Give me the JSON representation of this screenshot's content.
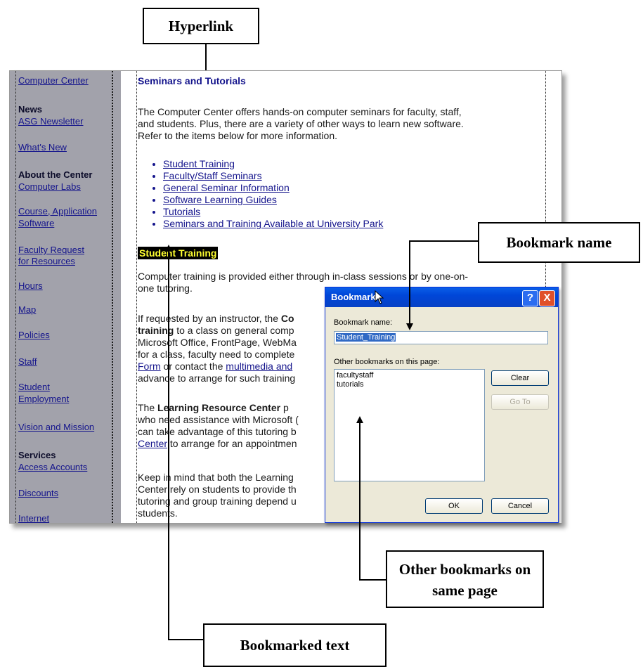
{
  "callouts": {
    "hyperlink": "Hyperlink",
    "bookmark_name": "Bookmark name",
    "other_bookmarks": "Other bookmarks on same page",
    "bookmarked_text": "Bookmarked text"
  },
  "sidebar": {
    "top_link": "Computer Center",
    "news_head": "News",
    "asg": "ASG Newsletter",
    "whats_new": "What's New",
    "about_head": "About the Center",
    "labs": "Computer Labs",
    "course1": "Course, Application",
    "course2": "Software",
    "faculty1": "Faculty Request",
    "faculty2": "for Resources",
    "hours": "Hours",
    "map": "Map",
    "policies": "Policies",
    "staff": "Staff",
    "student1": "Student",
    "student2": "Employment",
    "vision": "Vision and Mission",
    "services_head": "Services",
    "access": "Access Accounts",
    "discounts": "Discounts",
    "internet": "Internet"
  },
  "content": {
    "title": "Seminars and Tutorials",
    "p1l1": "The Computer Center offers hands-on computer seminars for faculty, staff,",
    "p1l2": "and students.  Plus, there are a variety of other ways to learn new software.",
    "p1l3": "Refer to the items below for more information.",
    "links": [
      "Student Training",
      "Faculty/Staff Seminars",
      "General Seminar Information",
      "Software Learning Guides",
      "Tutorials",
      "Seminars and Training Available at University Park"
    ],
    "bookmarked": "Student Training",
    "p2l1": "Computer training is provided either through in-class sessions or by one-on-",
    "p2l2": "one tutoring.",
    "p3l1a": "If requested by an instructor, the ",
    "p3l1b": "Co",
    "p3l2a": "training",
    "p3l2b": " to a class on general comp",
    "p3l3": "Microsoft Office, FrontPage, WebMa",
    "p3l4": "for a class, faculty need to complete",
    "p3l5a": "Form",
    "p3l5b": " or contact the ",
    "p3l5c": "multimedia and",
    "p3l6": "advance to arrange for such training",
    "p4l1a": "The ",
    "p4l1b": "Learning Resource Center",
    "p4l1c": " p",
    "p4l2": "who need assistance with Microsoft (",
    "p4l3": "can take advantage of this tutoring b",
    "p4l4a": "Center",
    "p4l4b": " to arrange for an appointmen",
    "p5l1": "Keep in mind that both the Learning",
    "p5l2": "Center rely on students to provide th",
    "p5l3": "tutoring and group training depend u",
    "p5l4": "students."
  },
  "dialog": {
    "title": "Bookmark",
    "help": "?",
    "close": "X",
    "name_label": "Bookmark name:",
    "name_value": "Student_Training",
    "others_label": "Other bookmarks on this page:",
    "others": [
      "facultystaff",
      "tutorials"
    ],
    "clear": "Clear",
    "goto": "Go To",
    "ok": "OK",
    "cancel": "Cancel"
  }
}
